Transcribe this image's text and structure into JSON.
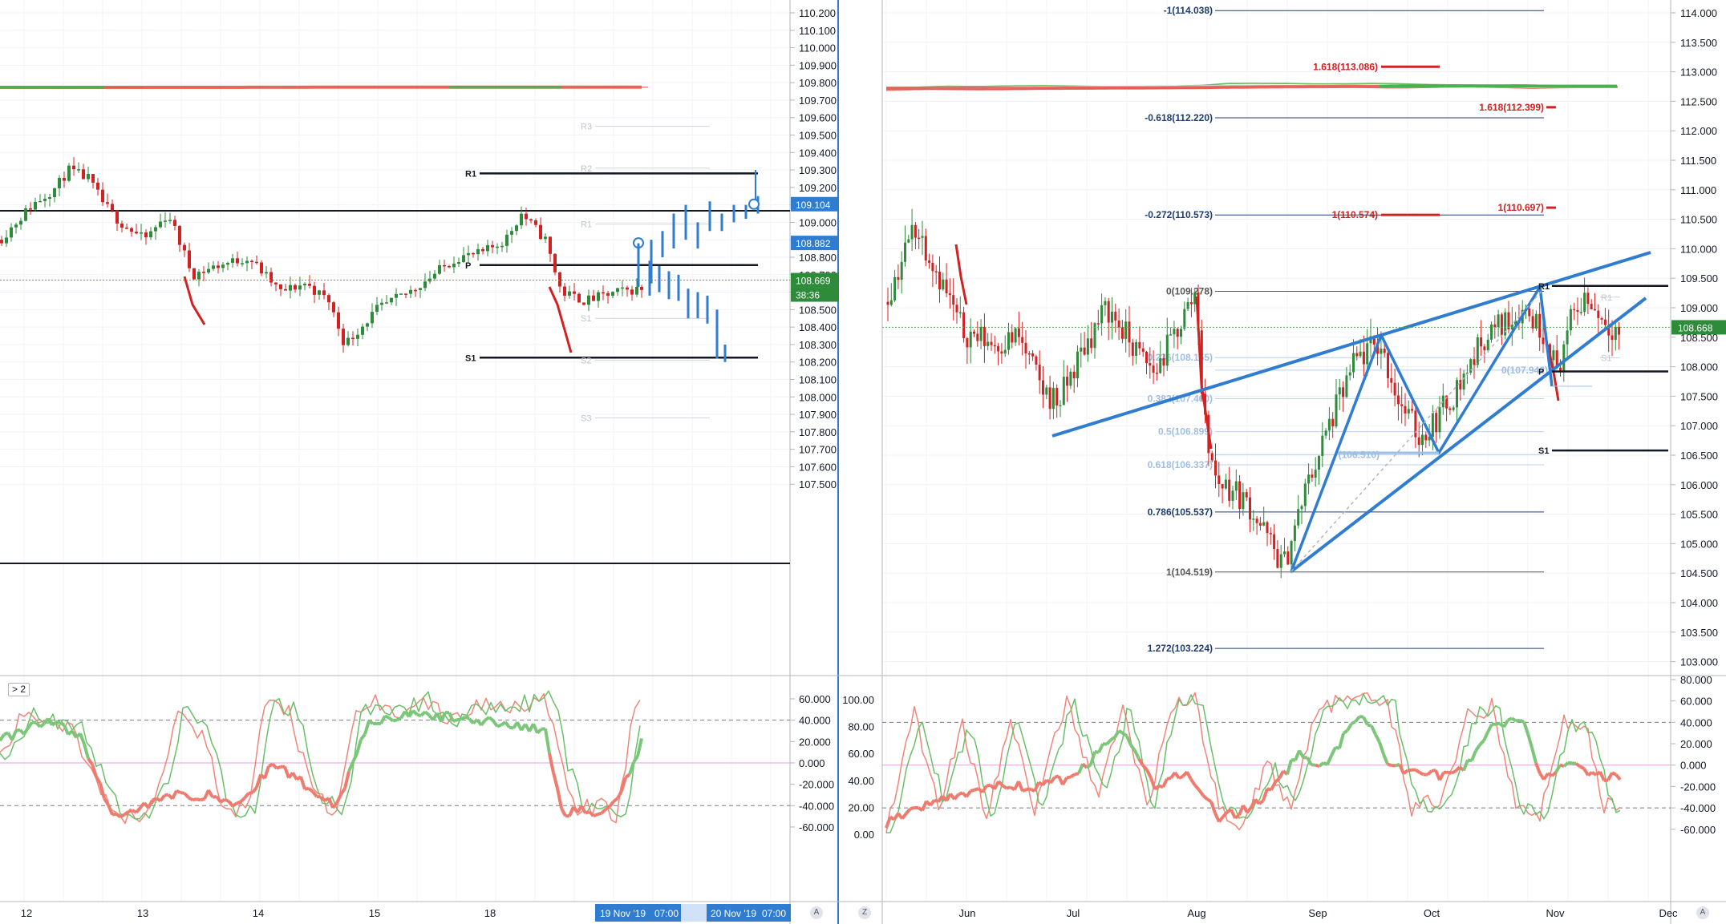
{
  "left": {
    "price_ticks": [
      "110.200",
      "110.100",
      "110.000",
      "109.900",
      "109.800",
      "109.700",
      "109.600",
      "109.500",
      "109.400",
      "109.300",
      "109.200",
      "109.100",
      "109.000",
      "108.900",
      "108.800",
      "108.700",
      "108.600",
      "108.500",
      "108.400",
      "108.300",
      "108.200",
      "108.100",
      "108.000",
      "107.900",
      "107.800",
      "107.700",
      "107.600",
      "107.500"
    ],
    "date_ticks": [
      "12",
      "13",
      "14",
      "15",
      "18"
    ],
    "price_tags": [
      {
        "text": "109.104",
        "color": "#2f7cd1",
        "value": 109.104
      },
      {
        "text": "108.882",
        "color": "#2f7cd1",
        "value": 108.882
      },
      {
        "text": "108.669",
        "color": "#2e8b3a",
        "value": 108.669
      },
      {
        "text": "38:36",
        "color": "#2e8b3a",
        "value": 108.58
      }
    ],
    "pivots": [
      {
        "label": "R1",
        "value": 109.28,
        "faded": false
      },
      {
        "label": "P",
        "value": 108.755,
        "faded": false
      },
      {
        "label": "S1",
        "value": 108.225,
        "faded": false
      },
      {
        "label": "R3",
        "value": 109.55,
        "faded": true
      },
      {
        "label": "R2",
        "value": 109.31,
        "faded": true
      },
      {
        "label": "R1",
        "value": 108.99,
        "faded": true
      },
      {
        "label": "S1",
        "value": 108.45,
        "faded": true
      },
      {
        "label": "S2",
        "value": 108.21,
        "faded": true
      },
      {
        "label": "S3",
        "value": 107.88,
        "faded": true
      }
    ],
    "time_labels": [
      "19 Nov '19",
      "07:00",
      "20 Nov '19",
      "07:00"
    ],
    "osc_ticks": [
      "60.000",
      "40.000",
      "20.000",
      "0.000",
      "-20.000",
      "-40.000",
      "-60.000"
    ],
    "osc_button": "> 2"
  },
  "right": {
    "price_ticks": [
      "114.000",
      "113.500",
      "113.000",
      "112.500",
      "112.000",
      "111.500",
      "111.000",
      "110.500",
      "110.000",
      "109.500",
      "109.000",
      "108.500",
      "108.000",
      "107.500",
      "107.000",
      "106.500",
      "106.000",
      "105.500",
      "105.000",
      "104.500",
      "104.000",
      "103.500",
      "103.000"
    ],
    "date_ticks": [
      "Jun",
      "Jul",
      "Aug",
      "Sep",
      "Oct",
      "Nov",
      "Dec"
    ],
    "price_tag": {
      "text": "108.668",
      "color": "#2e8b3a",
      "value": 108.668
    },
    "fib_labels": [
      {
        "text": "-1(114.038)",
        "value": 114.038,
        "color": "#1f3d6e",
        "faded": false
      },
      {
        "text": "1.618(113.086)",
        "value": 113.086,
        "color": "#d32020",
        "faded": false
      },
      {
        "text": "1.618(112.399)",
        "value": 112.399,
        "color": "#d32020",
        "faded": false
      },
      {
        "text": "-0.618(112.220)",
        "value": 112.22,
        "color": "#1f3d6e",
        "faded": false
      },
      {
        "text": "-0.272(110.573)",
        "value": 110.573,
        "color": "#1f3d6e",
        "faded": false
      },
      {
        "text": "1(110.574)",
        "value": 110.574,
        "color": "#d32020",
        "faded": false
      },
      {
        "text": "1(110.697)",
        "value": 110.697,
        "color": "#d32020",
        "faded": false
      },
      {
        "text": "0(109.278)",
        "value": 109.278,
        "color": "#555555",
        "faded": false
      },
      {
        "text": "0.236(108.155)",
        "value": 108.155,
        "color": "#8fb3de",
        "faded": true
      },
      {
        "text": "0(107.942)",
        "value": 107.942,
        "color": "#8fb3de",
        "faded": true
      },
      {
        "text": "0.382(107.460)",
        "value": 107.46,
        "color": "#8fb3de",
        "faded": true
      },
      {
        "text": "0.5(106.899)",
        "value": 106.899,
        "color": "#8fb3de",
        "faded": true
      },
      {
        "text": "(106.510)",
        "value": 106.51,
        "color": "#8fb3de",
        "faded": true
      },
      {
        "text": "0.618(106.337)",
        "value": 106.337,
        "color": "#8fb3de",
        "faded": true
      },
      {
        "text": "0.786(105.537)",
        "value": 105.537,
        "color": "#1f3d6e",
        "faded": false
      },
      {
        "text": "1(104.519)",
        "value": 104.519,
        "color": "#555555",
        "faded": false
      },
      {
        "text": "1.272(103.224)",
        "value": 103.224,
        "color": "#1f3d6e",
        "faded": false
      }
    ],
    "pivots": [
      {
        "label": "R1",
        "value": 109.37
      },
      {
        "label": "P",
        "value": 107.92
      },
      {
        "label": "S1",
        "value": 106.58
      }
    ],
    "faded_pivots": [
      {
        "label": "R1",
        "value": 109.18
      },
      {
        "label": "S1",
        "value": 108.15
      }
    ],
    "osc_left_ticks": [
      "100.00",
      "80.00",
      "60.00",
      "40.00",
      "20.00",
      "0.00"
    ],
    "osc_right_ticks": [
      "80.000",
      "60.000",
      "40.000",
      "20.000",
      "0.000",
      "-20.000",
      "-40.000",
      "-60.000"
    ]
  },
  "bottom_buttons": {
    "left": "A",
    "middle": "Z",
    "right": "A"
  },
  "colors": {
    "up": "#2e8b3a",
    "down": "#d32020",
    "band_red": "#f0857a",
    "band_green": "#6abf69",
    "ma_red": "#e8524a",
    "ma_green": "#4caf50",
    "trend": "#2f7cd1"
  }
}
